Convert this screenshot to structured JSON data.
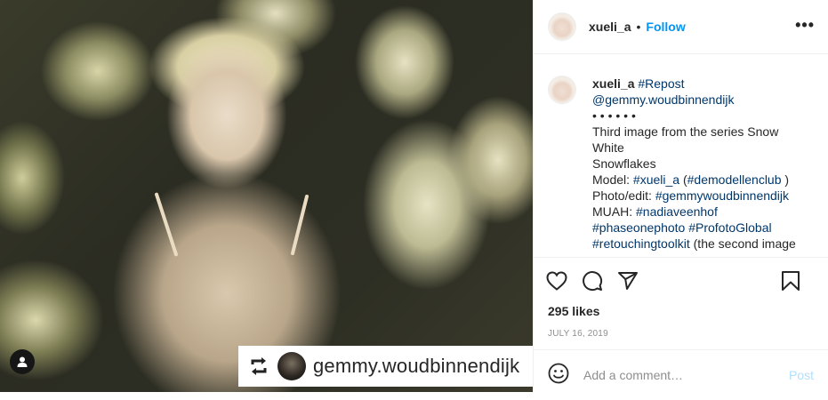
{
  "post": {
    "username": "xueli_a",
    "follow_label": "Follow",
    "dot": "•",
    "more_label": "•••"
  },
  "photo": {
    "repost_username": "gemmy.woudbinnendijk"
  },
  "caption": {
    "username": "xueli_a",
    "line1_tag": "#Repost",
    "line2": "@gemmy.woudbinnendijk",
    "line3": "• • • • • •",
    "line4": "Third image from the series Snow",
    "line5": "White",
    "line6": "Snowflakes",
    "model_label": "Model: ",
    "model_tag": "#xueli_a",
    "model_rest_open": " (",
    "model_tag2": "#demodellenclub",
    "model_rest_close": " )",
    "photo_label": "Photo/edit: ",
    "photo_tag": "#gemmywoudbinnendijk",
    "muah_label": "MUAH: ",
    "muah_tag": "#nadiaveenhof",
    "tag_phaseone": "#phaseonephoto",
    "tag_profoto": "#ProfotoGlobal",
    "tag_retouch": "#retouchingtoolkit",
    "retouch_rest": " (the second image"
  },
  "stats": {
    "likes": "295 likes",
    "date": "JULY 16, 2019"
  },
  "comment": {
    "placeholder": "Add a comment…",
    "post_label": "Post"
  },
  "colors": {
    "link_blue": "#0095f6",
    "hashtag": "#00376b",
    "post_disabled": "#b2dffc"
  },
  "icons": [
    "heart-icon",
    "comment-icon",
    "share-icon",
    "bookmark-icon",
    "emoji-icon",
    "repost-icon",
    "user-tag-icon",
    "more-icon"
  ]
}
